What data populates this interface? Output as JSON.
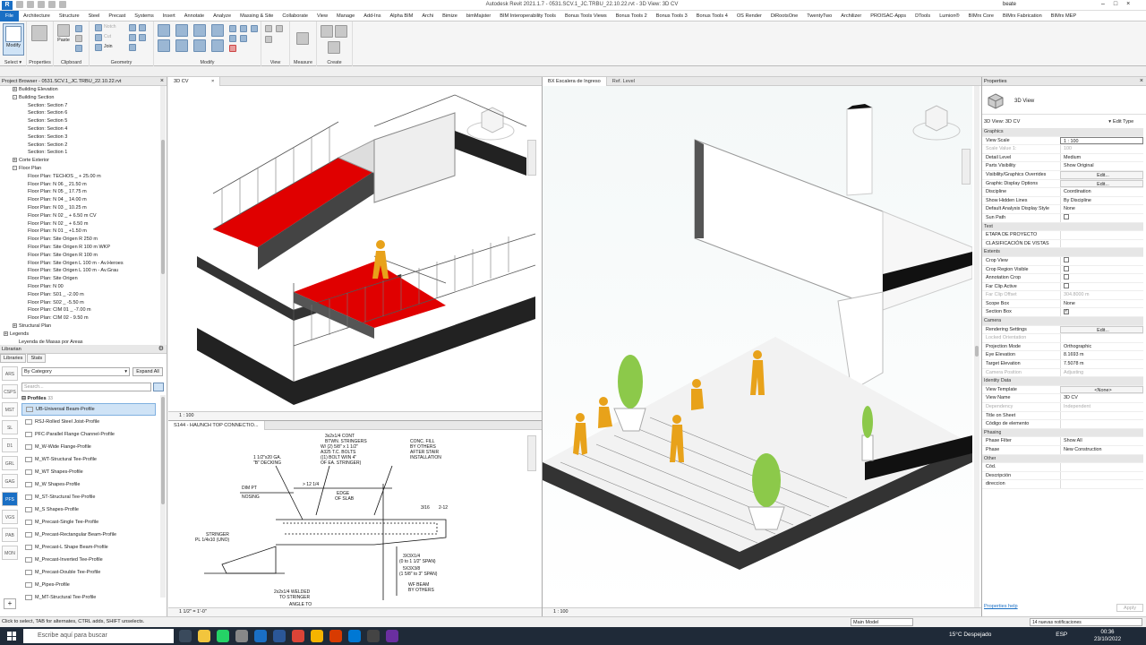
{
  "titlebar": {
    "title": "Autodesk Revit 2021.1.7 - 0531.SCV.1_JC.TRBU_22.10.22.rvt - 3D View: 3D CV",
    "user": "beate"
  },
  "tabs": [
    "File",
    "Architecture",
    "Structure",
    "Steel",
    "Precast",
    "Systems",
    "Insert",
    "Annotate",
    "Analyze",
    "Massing & Site",
    "Collaborate",
    "View",
    "Manage",
    "Add-Ins",
    "Alpha BIM",
    "Archi",
    "Bimize",
    "bimMajster",
    "BIM Interoperability Tools",
    "Bonus Tools Views",
    "Bonus Tools 2",
    "Bonus Tools 3",
    "Bonus Tools 4",
    "OS Render",
    "DiRootsOne",
    "TwentyTwo",
    "Archilizer",
    "PROISAC-Apps",
    "DTools",
    "Lumion®",
    "BIMrx Core",
    "BIMrx Fabrication",
    "BIMrx MEP"
  ],
  "ribbon": {
    "modify": "Modify",
    "select": "Select ▾",
    "properties": "Properties",
    "paste": "Paste",
    "clipboard": "Clipboard",
    "geometry": "Geometry",
    "modify_group": "Modify",
    "view": "View",
    "measure": "Measure",
    "create": "Create",
    "notch": "Notch",
    "cut": "Cut",
    "join": "Join"
  },
  "project_browser": {
    "title": "Project Browser - 0531.SCV.1_JC.TRBU_22.10.22.rvt",
    "items": [
      {
        "label": "Building Elevation",
        "level": 1,
        "exp": "+"
      },
      {
        "label": "Building Section",
        "level": 1,
        "exp": "-"
      },
      {
        "label": "Section: Section 7",
        "level": 2
      },
      {
        "label": "Section: Section 6",
        "level": 2
      },
      {
        "label": "Section: Section 5",
        "level": 2
      },
      {
        "label": "Section: Section 4",
        "level": 2
      },
      {
        "label": "Section: Section 3",
        "level": 2
      },
      {
        "label": "Section: Section 2",
        "level": 2
      },
      {
        "label": "Section: Section 1",
        "level": 2
      },
      {
        "label": "Corte Exterior",
        "level": 1,
        "exp": "+"
      },
      {
        "label": "Floor Plan",
        "level": 1,
        "exp": "-"
      },
      {
        "label": "Floor Plan: TECHOS _ + 25.00 m",
        "level": 2
      },
      {
        "label": "Floor Plan: N 06 _ 21.50 m",
        "level": 2
      },
      {
        "label": "Floor Plan: N 05 _ 17.75 m",
        "level": 2
      },
      {
        "label": "Floor Plan: N 04 _ 14.00 m",
        "level": 2
      },
      {
        "label": "Floor Plan: N 03 _ 10.25 m",
        "level": 2
      },
      {
        "label": "Floor Plan: N 02 _ + 6.50 m CV",
        "level": 2
      },
      {
        "label": "Floor Plan: N 02 _ + 6.50 m",
        "level": 2
      },
      {
        "label": "Floor Plan: N 01 _ +1.50 m",
        "level": 2
      },
      {
        "label": "Floor Plan: Site Origen R 250 m",
        "level": 2
      },
      {
        "label": "Floor Plan: Site Origen R 100 m WKP",
        "level": 2
      },
      {
        "label": "Floor Plan: Site Origen R 100 m",
        "level": 2
      },
      {
        "label": "Floor Plan: Site Origen L 100 m - Av.Heroes",
        "level": 2
      },
      {
        "label": "Floor Plan: Site Origen L 100 m - Av.Grau",
        "level": 2
      },
      {
        "label": "Floor Plan: Site Origen",
        "level": 2
      },
      {
        "label": "Floor Plan: N 00",
        "level": 2
      },
      {
        "label": "Floor Plan: S01 _ -2.00 m",
        "level": 2
      },
      {
        "label": "Floor Plan: S02 _ -5.50 m",
        "level": 2
      },
      {
        "label": "Floor Plan: CIM 01 _ -7.00 m",
        "level": 2
      },
      {
        "label": "Floor Plan: CIM 02 - 9.50 m",
        "level": 2
      },
      {
        "label": "Structural Plan",
        "level": 1,
        "exp": "+"
      },
      {
        "label": "Legends",
        "level": 0,
        "exp": "+"
      },
      {
        "label": "Leyenda de Masas por Areas",
        "level": 1
      }
    ]
  },
  "library": {
    "title": "Librarian",
    "tabs": [
      "Libraries",
      "Stats"
    ],
    "side": [
      "ARS",
      "CSPS",
      "MST",
      "SL",
      "D1",
      "GRL",
      "GAG",
      "PFS",
      "VGS",
      "PAB",
      "MON"
    ],
    "category": "By Category",
    "expand": "Expand All",
    "search_placeholder": "Search...",
    "group": "Profiles",
    "group_count": "33",
    "items": [
      "UB-Universal Beam-Profile",
      "RSJ-Rolled Steel Joist-Profile",
      "PFC-Parallel Flange Channel-Profile",
      "M_W-Wide Flange-Profile",
      "M_WT-Structural Tee-Profile",
      "M_WT Shapes-Profile",
      "M_W Shapes-Profile",
      "M_ST-Structural Tee-Profile",
      "M_S Shapes-Profile",
      "M_Precast-Single Tee-Profile",
      "M_Precast-Rectangular Beam-Profile",
      "M_Precast-L Shape Beam-Profile",
      "M_Precast-Inverted Tee-Profile",
      "M_Precast-Double Tee-Profile",
      "M_Pipes-Profile",
      "M_MT-Structural Tee-Profile"
    ]
  },
  "views": {
    "v3d_tab": "3D CV",
    "v3d_scale": "1 : 100",
    "vdet_tab": "S144 - HAUNCH TOP CONNECTIO...",
    "vdet_scale": "1 1/2\" = 1'-0\"",
    "vstair_tab": "BX Escalera de Ingreso",
    "vstair_tab2": "Ref. Level",
    "vstair_scale": "1 : 100",
    "detail_notes": [
      "3x2x1/4 CONT",
      "BTWN. STRINGERS",
      "W/ (2) 5/8\" x 1 1/2\"",
      "A325 T.C. BOLTS",
      "((1) BOLT W/IN 4\"",
      "OF EA. STRINGER)",
      "1 1/2\"x20 GA.",
      "\"B\" DECKING",
      "CONC. FILL",
      "BY OTHERS",
      "AFTER STAIR",
      "INSTALLATION",
      "DIM PT",
      "> 12 1/4",
      "NOSING",
      "EDGE",
      "OF SLAB",
      "3/16",
      "2-12",
      "STRINGER",
      "PL 1/4x10 (UNO)",
      "2x2x1/4 WELDED",
      "TO STRINGER",
      "3X3X1/4",
      "(0 to 1 1/2\" SPAN)",
      "5X3X3/8",
      "(1 5/8\" to 3\" SPAN)",
      "WF BEAM",
      "BY OTHERS",
      "ANGLE TO"
    ]
  },
  "properties": {
    "title": "Properties",
    "type_name": "3D View",
    "selector": "3D View: 3D CV",
    "edit_type": "Edit Type",
    "rows": [
      {
        "sec": "Graphics"
      },
      {
        "k": "View Scale",
        "v": "1 : 100",
        "inp": true
      },
      {
        "k": "Scale Value    1:",
        "v": "100",
        "dim": true
      },
      {
        "k": "Detail Level",
        "v": "Medium"
      },
      {
        "k": "Parts Visibility",
        "v": "Show Original"
      },
      {
        "k": "Visibility/Graphics Overrides",
        "v": "Edit...",
        "btn": true
      },
      {
        "k": "Graphic Display Options",
        "v": "Edit...",
        "btn": true
      },
      {
        "k": "Discipline",
        "v": "Coordination"
      },
      {
        "k": "Show Hidden Lines",
        "v": "By Discipline"
      },
      {
        "k": "Default Analysis Display Style",
        "v": "None"
      },
      {
        "k": "Sun Path",
        "cb": false
      },
      {
        "sec": "Text"
      },
      {
        "k": "ETAPA DE PROYECTO",
        "v": ""
      },
      {
        "k": "CLASIFICACIÓN DE VISTAS",
        "v": ""
      },
      {
        "sec": "Extents"
      },
      {
        "k": "Crop View",
        "cb": false
      },
      {
        "k": "Crop Region Visible",
        "cb": false
      },
      {
        "k": "Annotation Crop",
        "cb": false
      },
      {
        "k": "Far Clip Active",
        "cb": false
      },
      {
        "k": "Far Clip Offset",
        "v": "304.8000 m",
        "dim": true
      },
      {
        "k": "Scope Box",
        "v": "None"
      },
      {
        "k": "Section Box",
        "cb": true
      },
      {
        "sec": "Camera"
      },
      {
        "k": "Rendering Settings",
        "v": "Edit...",
        "btn": true
      },
      {
        "k": "Locked Orientation",
        "v": "",
        "dim": true
      },
      {
        "k": "Projection Mode",
        "v": "Orthographic"
      },
      {
        "k": "Eye Elevation",
        "v": "8.1693 m"
      },
      {
        "k": "Target Elevation",
        "v": "7.5078 m"
      },
      {
        "k": "Camera Position",
        "v": "Adjusting",
        "dim": true
      },
      {
        "sec": "Identity Data"
      },
      {
        "k": "View Template",
        "v": "<None>",
        "btn": true
      },
      {
        "k": "View Name",
        "v": "3D CV"
      },
      {
        "k": "Dependency",
        "v": "Independent",
        "dim": true
      },
      {
        "k": "Title on Sheet",
        "v": ""
      },
      {
        "k": "Código de elemento",
        "v": ""
      },
      {
        "sec": "Phasing"
      },
      {
        "k": "Phase Filter",
        "v": "Show All"
      },
      {
        "k": "Phase",
        "v": "New Construction"
      },
      {
        "sec": "Other"
      },
      {
        "k": "Cód.",
        "v": ""
      },
      {
        "k": "Descripción",
        "v": ""
      },
      {
        "k": "direccion",
        "v": ""
      }
    ],
    "help": "Properties help",
    "apply": "Apply"
  },
  "status": {
    "text": "Click to select, TAB for alternates, CTRL adds, SHIFT unselects.",
    "model": "Main Model",
    "notifications": "14 nuevas notificaciones"
  },
  "taskbar": {
    "search": "Escribe aquí para buscar",
    "weather": "15°C  Despejado",
    "lang": "ESP",
    "time": "00:36",
    "date": "23/10/2022"
  },
  "colors": {
    "accent": "#1a6fc4",
    "stair_red": "#e00000",
    "figure": "#e8a21a"
  }
}
